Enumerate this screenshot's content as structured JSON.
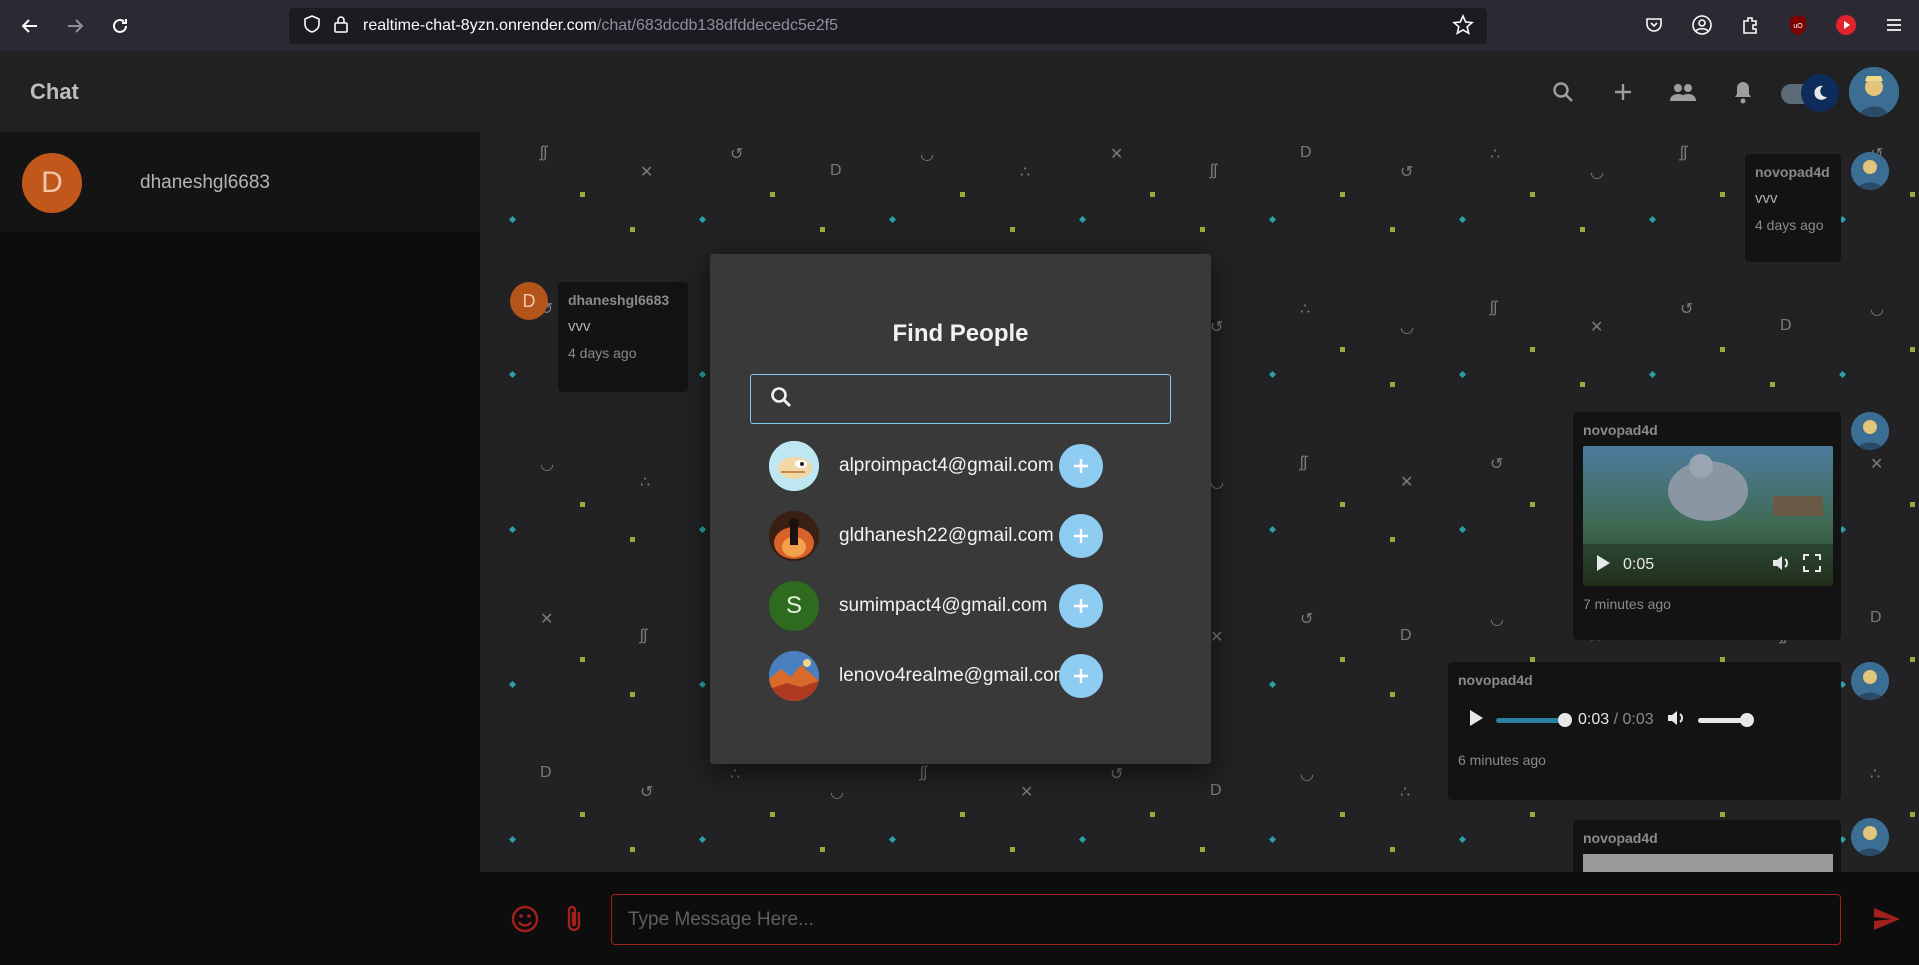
{
  "browser": {
    "url_host": "realtime-chat-8yzn.onrender.com",
    "url_path": "/chat/683dcdb138dfddecedc5e2f5"
  },
  "header": {
    "title": "Chat"
  },
  "sidebar": {
    "contacts": [
      {
        "initial": "D",
        "name": "dhaneshgl6683"
      }
    ]
  },
  "messages": [
    {
      "sender": "novopad4d",
      "text": "vvv",
      "time": "4 days ago"
    },
    {
      "initial": "D",
      "sender": "dhaneshgl6683",
      "text": "vvv",
      "time": "4 days ago"
    },
    {
      "sender": "novopad4d",
      "video_time": "0:05",
      "time": "7 minutes ago"
    },
    {
      "sender": "novopad4d",
      "audio_current": "0:03",
      "audio_sep": "/",
      "audio_total": "0:03",
      "time": "6 minutes ago"
    },
    {
      "sender": "novopad4d"
    }
  ],
  "composer": {
    "placeholder": "Type Message Here..."
  },
  "modal": {
    "title": "Find People",
    "search_placeholder": "",
    "people": [
      {
        "email": "alproimpact4@gmail.com",
        "avatar": "cartoon-face-icon"
      },
      {
        "email": "gldhanesh22@gmail.com",
        "avatar": "fire-figure-icon"
      },
      {
        "initial": "S",
        "email": "sumimpact4@gmail.com",
        "avatar_color": "#2e6b1f"
      },
      {
        "email": "lenovo4realme@gmail.com",
        "avatar": "landscape-icon"
      }
    ]
  },
  "colors": {
    "accent_blue": "#8fccf2",
    "input_border_red": "#a3201c",
    "sidebar_avatar": "#c2571b"
  }
}
